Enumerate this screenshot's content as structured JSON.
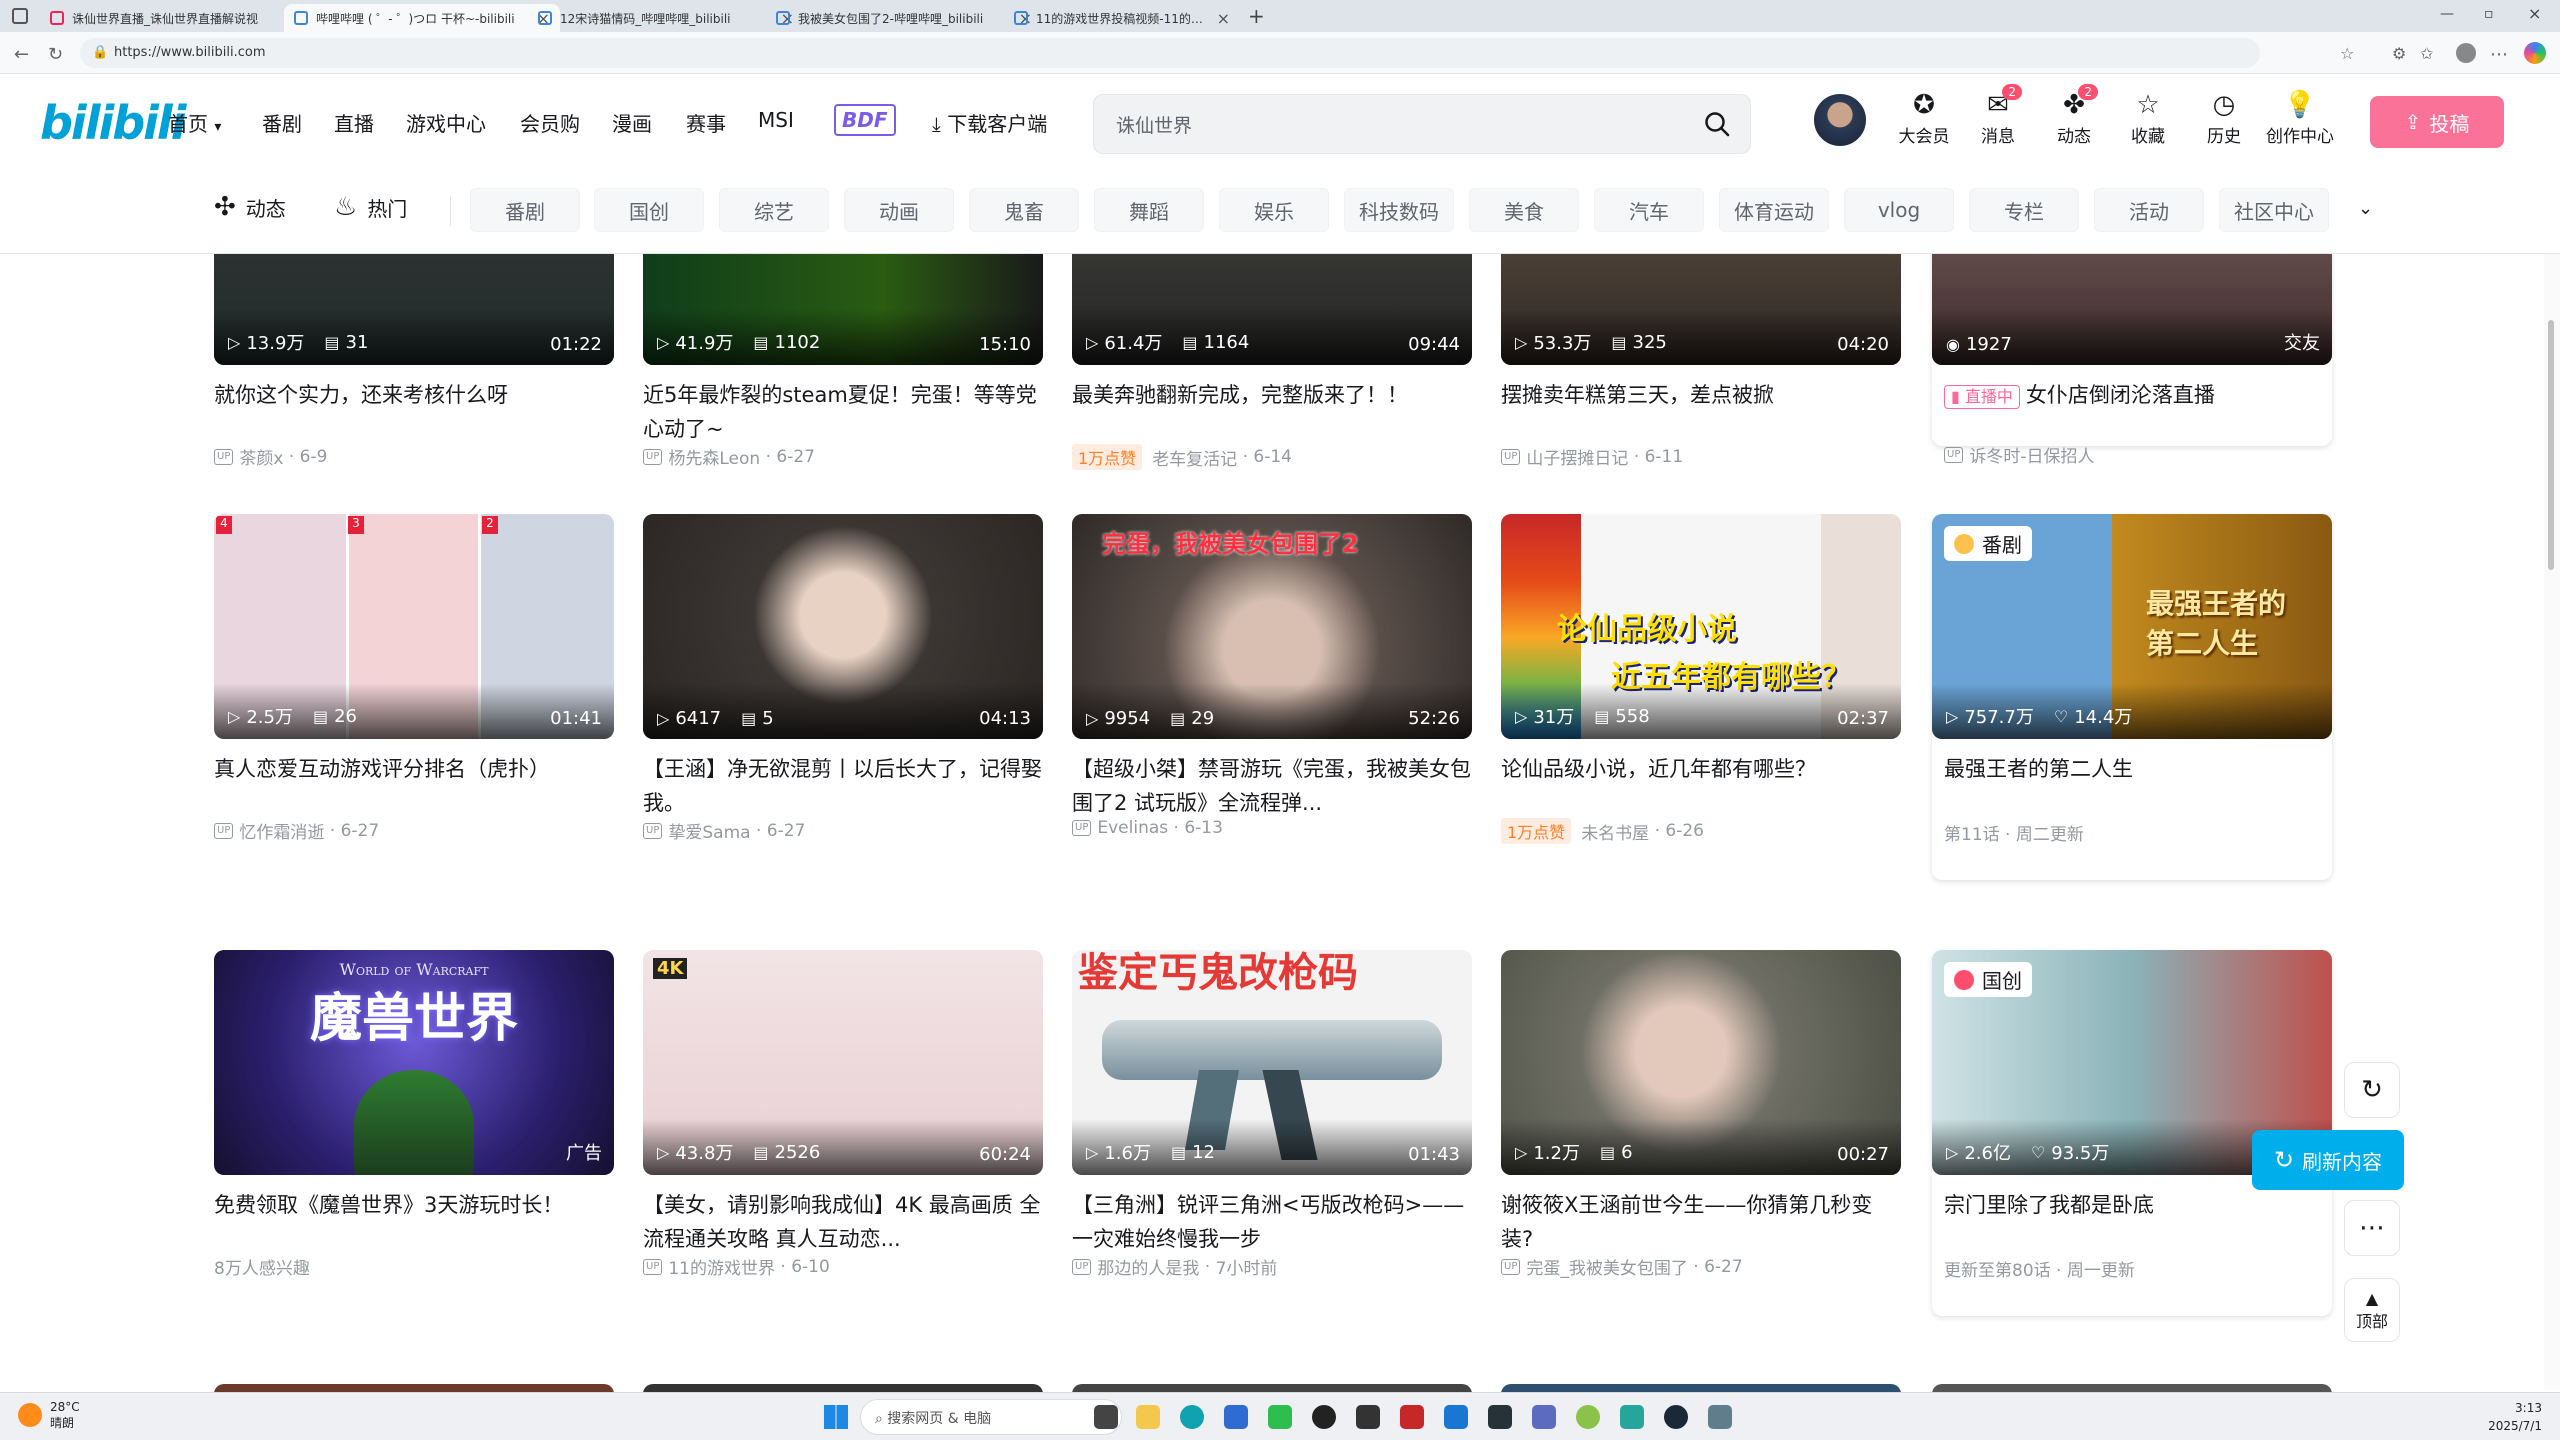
{
  "browser": {
    "tabs": [
      {
        "title": "诛仙世界直播_诛仙世界直播解说视"
      },
      {
        "title": "哔哩哔哩 ( ゜- ゜)つロ 干杯~-bilibili"
      },
      {
        "title": "12宋诗猫情码_哔哩哔哩_bilibili"
      },
      {
        "title": "我被美女包围了2-哔哩哔哩_bilibili"
      },
      {
        "title": "11的游戏世界投稿视频-11的游戏"
      }
    ],
    "url": "https://www.bilibili.com"
  },
  "header": {
    "logo": "bilibili",
    "nav": [
      "首页",
      "番剧",
      "直播",
      "游戏中心",
      "会员购",
      "漫画",
      "赛事",
      "MSI"
    ],
    "bdf": "BDF",
    "download": "下载客户端",
    "search_value": "诛仙世界",
    "icons": [
      {
        "label": "大会员",
        "badge": ""
      },
      {
        "label": "消息",
        "badge": "2"
      },
      {
        "label": "动态",
        "badge": "2"
      },
      {
        "label": "收藏",
        "badge": ""
      },
      {
        "label": "历史",
        "badge": ""
      },
      {
        "label": "创作中心",
        "badge": ""
      }
    ],
    "upload": "投稿"
  },
  "catbar": {
    "special": [
      "动态",
      "热门"
    ],
    "categories": [
      "番剧",
      "国创",
      "综艺",
      "动画",
      "鬼畜",
      "舞蹈",
      "娱乐",
      "科技数码",
      "美食",
      "汽车",
      "体育运动",
      "vlog",
      "专栏",
      "活动",
      "社区中心"
    ]
  },
  "cards": [
    {
      "plays": "13.9万",
      "danmaku": "31",
      "duration": "01:22",
      "title": "就你这个实力，还来考核什么呀",
      "author": "茶颜x",
      "date": "6-9",
      "hot": ""
    },
    {
      "plays": "41.9万",
      "danmaku": "1102",
      "duration": "15:10",
      "title": "近5年最炸裂的steam夏促！完蛋！等等党心动了~",
      "author": "杨先森Leon",
      "date": "6-27",
      "hot": ""
    },
    {
      "plays": "61.4万",
      "danmaku": "1164",
      "duration": "09:44",
      "title": "最美奔驰翻新完成，完整版来了！！",
      "author": "老车复活记",
      "date": "6-14",
      "hot": "1万点赞"
    },
    {
      "plays": "53.3万",
      "danmaku": "325",
      "duration": "04:20",
      "title": "摆摊卖年糕第三天，差点被掀",
      "author": "山子摆摊日记",
      "date": "6-11",
      "hot": ""
    },
    {
      "plays": "1927",
      "danmaku": "",
      "duration": "交友",
      "title": "女仆店倒闭沦落直播",
      "author": "诉冬时-日保招人",
      "date": "",
      "hot": "",
      "live": "直播中"
    },
    {
      "plays": "2.5万",
      "danmaku": "26",
      "duration": "01:41",
      "title": "真人恋爱互动游戏评分排名（虎扑）",
      "author": "忆作霜消逝",
      "date": "6-27",
      "hot": ""
    },
    {
      "plays": "6417",
      "danmaku": "5",
      "duration": "04:13",
      "title": "【王涵】净无欲混剪丨以后长大了，记得娶我。",
      "author": "挚爱Sama",
      "date": "6-27",
      "hot": ""
    },
    {
      "plays": "9954",
      "danmaku": "29",
      "duration": "52:26",
      "title": "【超级小桀】禁哥游玩《完蛋，我被美女包围了2 试玩版》全流程弹...",
      "author": "Evelinas",
      "date": "6-13",
      "hot": ""
    },
    {
      "plays": "31万",
      "danmaku": "558",
      "duration": "02:37",
      "title": "论仙品级小说，近几年都有哪些？",
      "author": "未名书屋",
      "date": "6-26",
      "hot": "1万点赞"
    },
    {
      "plays": "757.7万",
      "likes": "14.4万",
      "duration": "",
      "title": "最强王者的第二人生",
      "author": "",
      "date": "",
      "hot": "",
      "badge": "番剧",
      "sub": "第11话 · 周二更新"
    },
    {
      "plays": "",
      "danmaku": "",
      "duration": "广告",
      "title": "免费领取《魔兽世界》3天游玩时长！",
      "author": "",
      "date": "",
      "hot": "",
      "sub": "8万人感兴趣"
    },
    {
      "plays": "43.8万",
      "danmaku": "2526",
      "duration": "60:24",
      "title": "【美女，请别影响我成仙】4K 最高画质 全流程通关攻略 真人互动恋...",
      "author": "11的游戏世界",
      "date": "6-10",
      "hot": ""
    },
    {
      "plays": "1.6万",
      "danmaku": "12",
      "duration": "01:43",
      "title": "【三角洲】锐评三角洲<丐版改枪码>——一灾难始终慢我一步",
      "author": "那边的人是我",
      "date": "7小时前",
      "hot": ""
    },
    {
      "plays": "1.2万",
      "danmaku": "6",
      "duration": "00:27",
      "title": "谢筱筱X王涵前世今生——你猜第几秒变装?",
      "author": "完蛋_我被美女包围了",
      "date": "6-27",
      "hot": ""
    },
    {
      "plays": "2.6亿",
      "likes": "93.5万",
      "duration": "",
      "title": "宗门里除了我都是卧底",
      "author": "",
      "date": "",
      "hot": "",
      "badge": "国创",
      "sub": "更新至第80话 · 周一更新"
    }
  ],
  "thumb_text": {
    "wow_title": "World of Warcraft",
    "wow_cn": "魔兽世界",
    "c8_top": "完蛋，我被美女包围了2",
    "c9_line1": "论仙品级小说",
    "c9_line2": "近五年都有哪些？",
    "c10_title": "最强王者的第二人生",
    "c13_top": "鉴定丐鬼改枪码",
    "c12_4k": "4K"
  },
  "floating": {
    "refresh": "刷新内容",
    "top": "顶部"
  },
  "taskbar": {
    "weather_temp": "28°C",
    "weather_desc": "晴朗",
    "search": "搜索网页 & 电脑",
    "time": "3:13",
    "date": "2025/7/1"
  }
}
